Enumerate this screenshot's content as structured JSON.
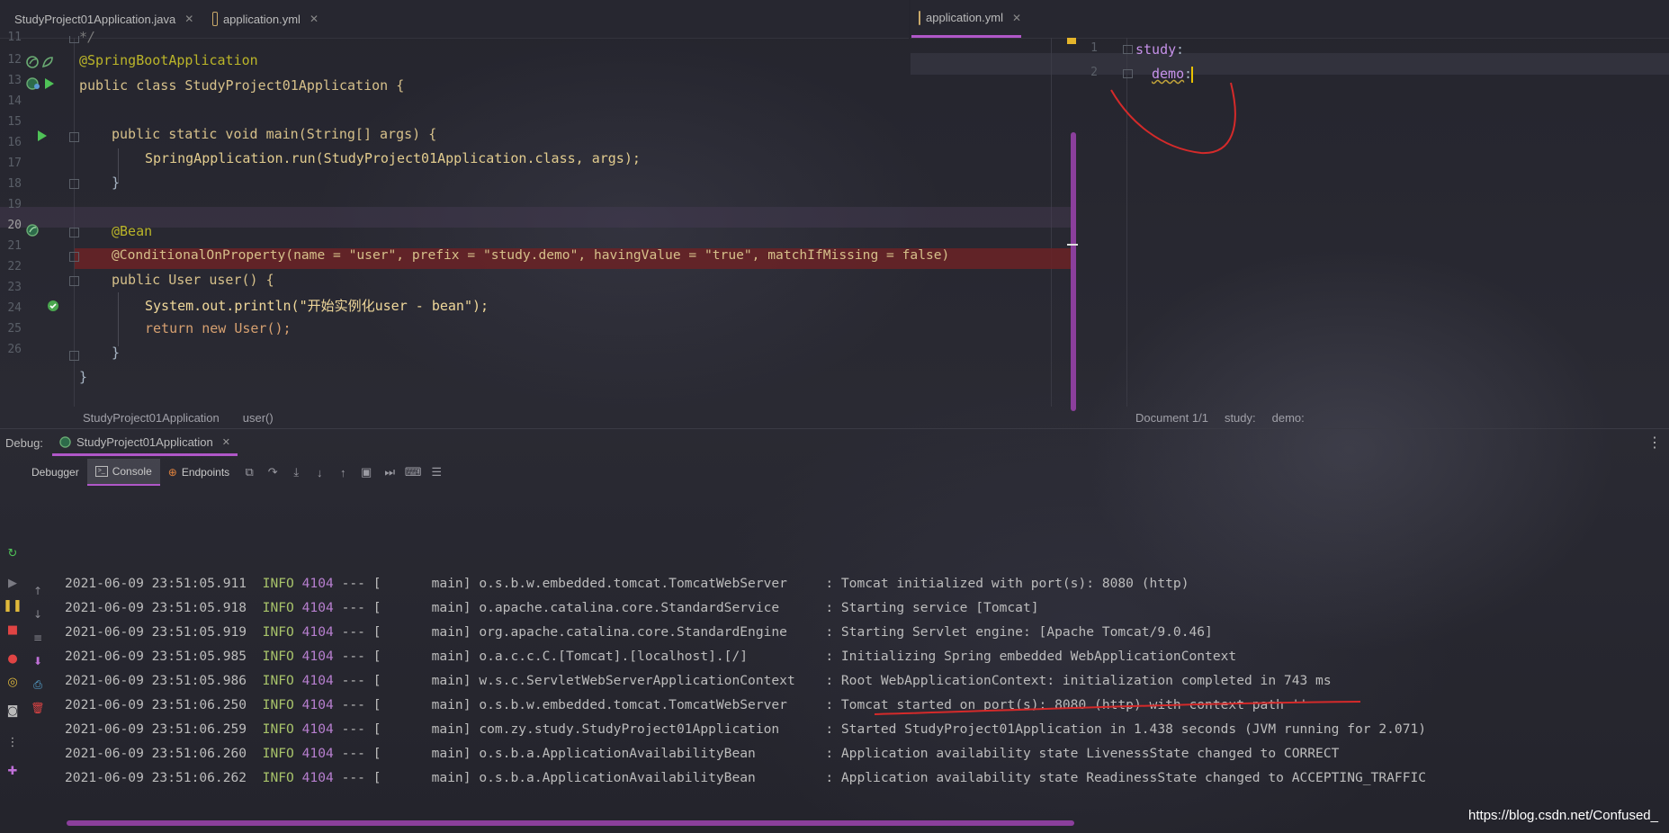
{
  "tabs_left": [
    {
      "label": "StudyProject01Application.java",
      "active": false
    },
    {
      "label": "application.yml",
      "active": false
    }
  ],
  "tabs_right": [
    {
      "label": "application.yml",
      "active": true
    }
  ],
  "editor_left": {
    "lines": [
      {
        "num": "11",
        "text": "*/"
      },
      {
        "num": "12",
        "text": "@SpringBootApplication"
      },
      {
        "num": "13",
        "text": "public class StudyProject01Application {"
      },
      {
        "num": "14",
        "text": ""
      },
      {
        "num": "15",
        "text": "public static void main(String[] args) {"
      },
      {
        "num": "16",
        "text": "SpringApplication.run(StudyProject01Application.class, args);"
      },
      {
        "num": "17",
        "text": "}"
      },
      {
        "num": "18",
        "text": ""
      },
      {
        "num": "19",
        "text": "@Bean"
      },
      {
        "num": "20",
        "text": "@ConditionalOnProperty(name = \"user\", prefix = \"study.demo\", havingValue = \"true\", matchIfMissing = false)"
      },
      {
        "num": "21",
        "text": "public User user() {"
      },
      {
        "num": "22",
        "text": "System.out.println(\"开始实例化user - bean\");"
      },
      {
        "num": "23",
        "text": "return new User();"
      },
      {
        "num": "24",
        "text": "}"
      },
      {
        "num": "25",
        "text": "}"
      },
      {
        "num": "26",
        "text": ""
      }
    ]
  },
  "editor_right": {
    "lines": [
      {
        "num": "1",
        "key": "study",
        "sep": ":"
      },
      {
        "num": "2",
        "key": "demo",
        "sep": ":"
      }
    ]
  },
  "breadcrumb_left": [
    "StudyProject01Application",
    "user()"
  ],
  "breadcrumb_right": [
    "Document 1/1",
    "study:",
    "demo:"
  ],
  "debug": {
    "label": "Debug:",
    "session": "StudyProject01Application",
    "subtabs": [
      "Debugger",
      "Console",
      "Endpoints"
    ]
  },
  "log": [
    {
      "ts": "2021-06-09 23:51:05.911",
      "level": "INFO",
      "pid": "4104",
      "sep": "--- [",
      "thread": "main]",
      "logger": "o.s.b.w.embedded.tomcat.TomcatWebServer",
      "msg": ": Tomcat initialized with port(s): 8080 (http)"
    },
    {
      "ts": "2021-06-09 23:51:05.918",
      "level": "INFO",
      "pid": "4104",
      "sep": "--- [",
      "thread": "main]",
      "logger": "o.apache.catalina.core.StandardService",
      "msg": ": Starting service [Tomcat]"
    },
    {
      "ts": "2021-06-09 23:51:05.919",
      "level": "INFO",
      "pid": "4104",
      "sep": "--- [",
      "thread": "main]",
      "logger": "org.apache.catalina.core.StandardEngine",
      "msg": ": Starting Servlet engine: [Apache Tomcat/9.0.46]"
    },
    {
      "ts": "2021-06-09 23:51:05.985",
      "level": "INFO",
      "pid": "4104",
      "sep": "--- [",
      "thread": "main]",
      "logger": "o.a.c.c.C.[Tomcat].[localhost].[/]",
      "msg": ": Initializing Spring embedded WebApplicationContext"
    },
    {
      "ts": "2021-06-09 23:51:05.986",
      "level": "INFO",
      "pid": "4104",
      "sep": "--- [",
      "thread": "main]",
      "logger": "w.s.c.ServletWebServerApplicationContext",
      "msg": ": Root WebApplicationContext: initialization completed in 743 ms"
    },
    {
      "ts": "2021-06-09 23:51:06.250",
      "level": "INFO",
      "pid": "4104",
      "sep": "--- [",
      "thread": "main]",
      "logger": "o.s.b.w.embedded.tomcat.TomcatWebServer",
      "msg": ": Tomcat started on port(s): 8080 (http) with context path ''"
    },
    {
      "ts": "2021-06-09 23:51:06.259",
      "level": "INFO",
      "pid": "4104",
      "sep": "--- [",
      "thread": "main]",
      "logger": "com.zy.study.StudyProject01Application",
      "msg": ": Started StudyProject01Application in 1.438 seconds (JVM running for 2.071)"
    },
    {
      "ts": "2021-06-09 23:51:06.260",
      "level": "INFO",
      "pid": "4104",
      "sep": "--- [",
      "thread": "main]",
      "logger": "o.s.b.a.ApplicationAvailabilityBean",
      "msg": ": Application availability state LivenessState changed to CORRECT"
    },
    {
      "ts": "2021-06-09 23:51:06.262",
      "level": "INFO",
      "pid": "4104",
      "sep": "--- [",
      "thread": "main]",
      "logger": "o.s.b.a.ApplicationAvailabilityBean",
      "msg": ": Application availability state ReadinessState changed to ACCEPTING_TRAFFIC"
    }
  ],
  "watermark": "https://blog.csdn.net/Confused_",
  "colors": {
    "accent": "#b057c8",
    "error_line": "#6b2226",
    "annotation_red": "#d42a2a"
  },
  "icons": [
    "java-file-icon",
    "yaml-file-icon",
    "close-icon",
    "spring-bean-icon",
    "run-icon",
    "fold-icon",
    "breakpoint-check-icon",
    "more-options-icon",
    "rerun-icon",
    "resume-icon",
    "pause-icon",
    "stop-icon",
    "view-breakpoints-icon",
    "mute-breakpoints-icon",
    "camera-icon",
    "settings-icon",
    "pin-icon",
    "up-arrow-icon",
    "down-arrow-icon",
    "soft-wrap-icon",
    "print-icon",
    "delete-icon",
    "step-over-icon",
    "step-into-icon",
    "force-step-into-icon",
    "step-out-icon",
    "run-to-cursor-icon",
    "evaluate-icon",
    "console-icon",
    "endpoints-icon",
    "layout-icon"
  ]
}
